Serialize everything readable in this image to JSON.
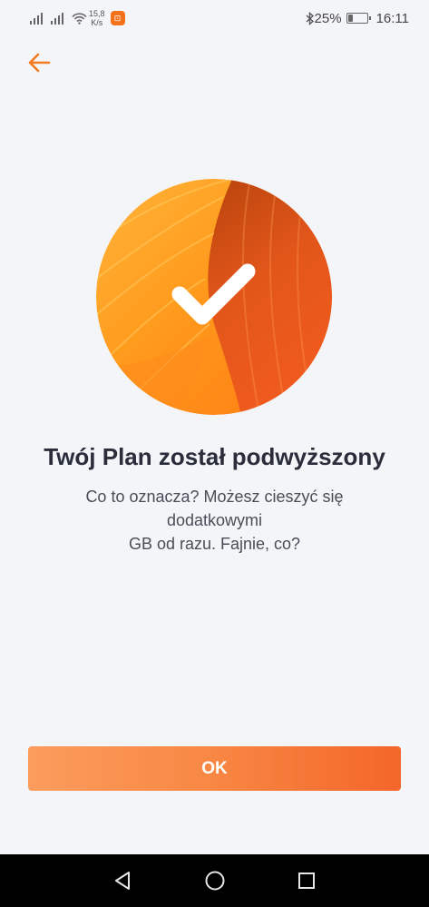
{
  "status_bar": {
    "speed_value": "15,8",
    "speed_unit": "K/s",
    "app_badge": "⊡",
    "battery": "25%",
    "battery_level": 0.25,
    "time": "16:11"
  },
  "icons": {
    "back": "arrow-left-icon",
    "hero": "checkmark-icon",
    "nav_back": "triangle-back-icon",
    "nav_home": "circle-home-icon",
    "nav_recents": "square-recents-icon"
  },
  "colors": {
    "accent": "#f47b20",
    "button_start": "#fb9c5d",
    "button_end": "#f4662a",
    "background": "#f4f5f9"
  },
  "main": {
    "title": "Twój Plan został podwyższony",
    "subtitle_line1": "Co to oznacza? Możesz cieszyć się dodatkowymi",
    "subtitle_line2": "GB od razu. Fajnie, co?",
    "ok_label": "OK"
  }
}
